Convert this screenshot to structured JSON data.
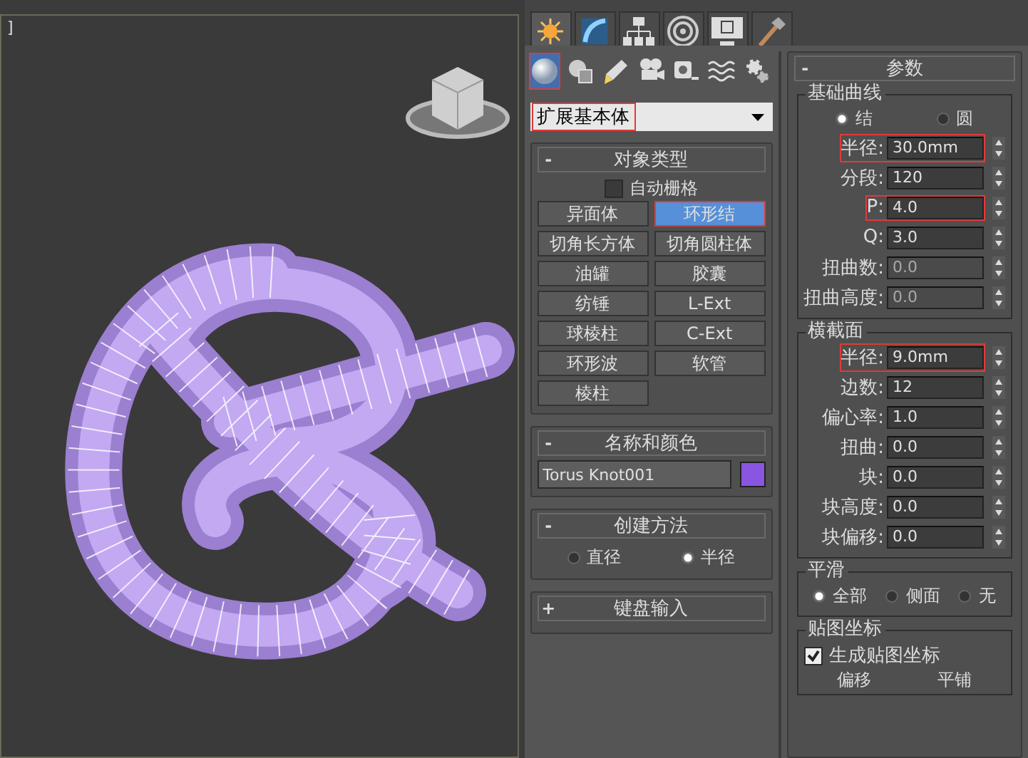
{
  "viewport": {
    "label": "]"
  },
  "command_tabs": [
    {
      "kind": "create",
      "selected": true
    },
    {
      "kind": "modify",
      "selected": false
    },
    {
      "kind": "hierarchy",
      "selected": false
    },
    {
      "kind": "motion",
      "selected": false
    },
    {
      "kind": "display",
      "selected": false
    },
    {
      "kind": "utilities",
      "selected": false
    }
  ],
  "category_icons": [
    {
      "kind": "geometry",
      "selected": true,
      "highlighted": true
    },
    {
      "kind": "shapes",
      "selected": false,
      "highlighted": false
    },
    {
      "kind": "lights",
      "selected": false,
      "highlighted": false
    },
    {
      "kind": "cameras",
      "selected": false,
      "highlighted": false
    },
    {
      "kind": "helpers",
      "selected": false,
      "highlighted": false
    },
    {
      "kind": "spacewarps",
      "selected": false,
      "highlighted": false
    },
    {
      "kind": "systems",
      "selected": false,
      "highlighted": false
    }
  ],
  "dropdown": {
    "value": "扩展基本体",
    "highlighted": true
  },
  "object_type": {
    "collapse": "-",
    "title": "对象类型",
    "autogrid": {
      "label": "自动栅格",
      "checked": false
    },
    "buttons": [
      {
        "label": "异面体",
        "selected": false,
        "highlighted": false
      },
      {
        "label": "环形结",
        "selected": true,
        "highlighted": true
      },
      {
        "label": "切角长方体",
        "selected": false,
        "highlighted": false
      },
      {
        "label": "切角圆柱体",
        "selected": false,
        "highlighted": false
      },
      {
        "label": "油罐",
        "selected": false,
        "highlighted": false
      },
      {
        "label": "胶囊",
        "selected": false,
        "highlighted": false
      },
      {
        "label": "纺锤",
        "selected": false,
        "highlighted": false
      },
      {
        "label": "L-Ext",
        "selected": false,
        "highlighted": false
      },
      {
        "label": "球棱柱",
        "selected": false,
        "highlighted": false
      },
      {
        "label": "C-Ext",
        "selected": false,
        "highlighted": false
      },
      {
        "label": "环形波",
        "selected": false,
        "highlighted": false
      },
      {
        "label": "软管",
        "selected": false,
        "highlighted": false
      },
      {
        "label": "棱柱",
        "selected": false,
        "highlighted": false
      }
    ]
  },
  "name_color": {
    "collapse": "-",
    "title": "名称和颜色",
    "name": "Torus Knot001",
    "color": "#8a55e0"
  },
  "creation_method": {
    "collapse": "-",
    "title": "创建方法",
    "options": [
      {
        "label": "直径",
        "selected": false
      },
      {
        "label": "半径",
        "selected": true
      }
    ]
  },
  "keyboard_entry": {
    "collapse": "+",
    "title": "键盘输入"
  },
  "parameters": {
    "collapse": "-",
    "title": "参数",
    "groups": [
      {
        "title": "基础曲线",
        "radios": [
          {
            "label": "结",
            "selected": true
          },
          {
            "label": "圆",
            "selected": false
          }
        ],
        "fields": [
          {
            "label": "半径:",
            "value": "30.0mm",
            "disabled": false,
            "highlighted": true
          },
          {
            "label": "分段:",
            "value": "120",
            "disabled": false,
            "highlighted": false
          },
          {
            "label": "P:",
            "value": "4.0",
            "disabled": false,
            "highlighted": true
          },
          {
            "label": "Q:",
            "value": "3.0",
            "disabled": false,
            "highlighted": false
          },
          {
            "label": "扭曲数:",
            "value": "0.0",
            "disabled": true,
            "highlighted": false
          },
          {
            "label": "扭曲高度:",
            "value": "0.0",
            "disabled": true,
            "highlighted": false
          }
        ]
      },
      {
        "title": "横截面",
        "fields": [
          {
            "label": "半径:",
            "value": "9.0mm",
            "disabled": false,
            "highlighted": true
          },
          {
            "label": "边数:",
            "value": "12",
            "disabled": false,
            "highlighted": false
          },
          {
            "label": "偏心率:",
            "value": "1.0",
            "disabled": false,
            "highlighted": false
          },
          {
            "label": "扭曲:",
            "value": "0.0",
            "disabled": false,
            "highlighted": false
          },
          {
            "label": "块:",
            "value": "0.0",
            "disabled": false,
            "highlighted": false
          },
          {
            "label": "块高度:",
            "value": "0.0",
            "disabled": false,
            "highlighted": false
          },
          {
            "label": "块偏移:",
            "value": "0.0",
            "disabled": false,
            "highlighted": false
          }
        ]
      },
      {
        "title": "平滑",
        "radios": [
          {
            "label": "全部",
            "selected": true
          },
          {
            "label": "侧面",
            "selected": false
          },
          {
            "label": "无",
            "selected": false
          }
        ]
      },
      {
        "title": "贴图坐标",
        "checkbox": {
          "label": "生成贴图坐标",
          "checked": true
        },
        "columns": [
          "偏移",
          "平铺"
        ]
      }
    ]
  }
}
